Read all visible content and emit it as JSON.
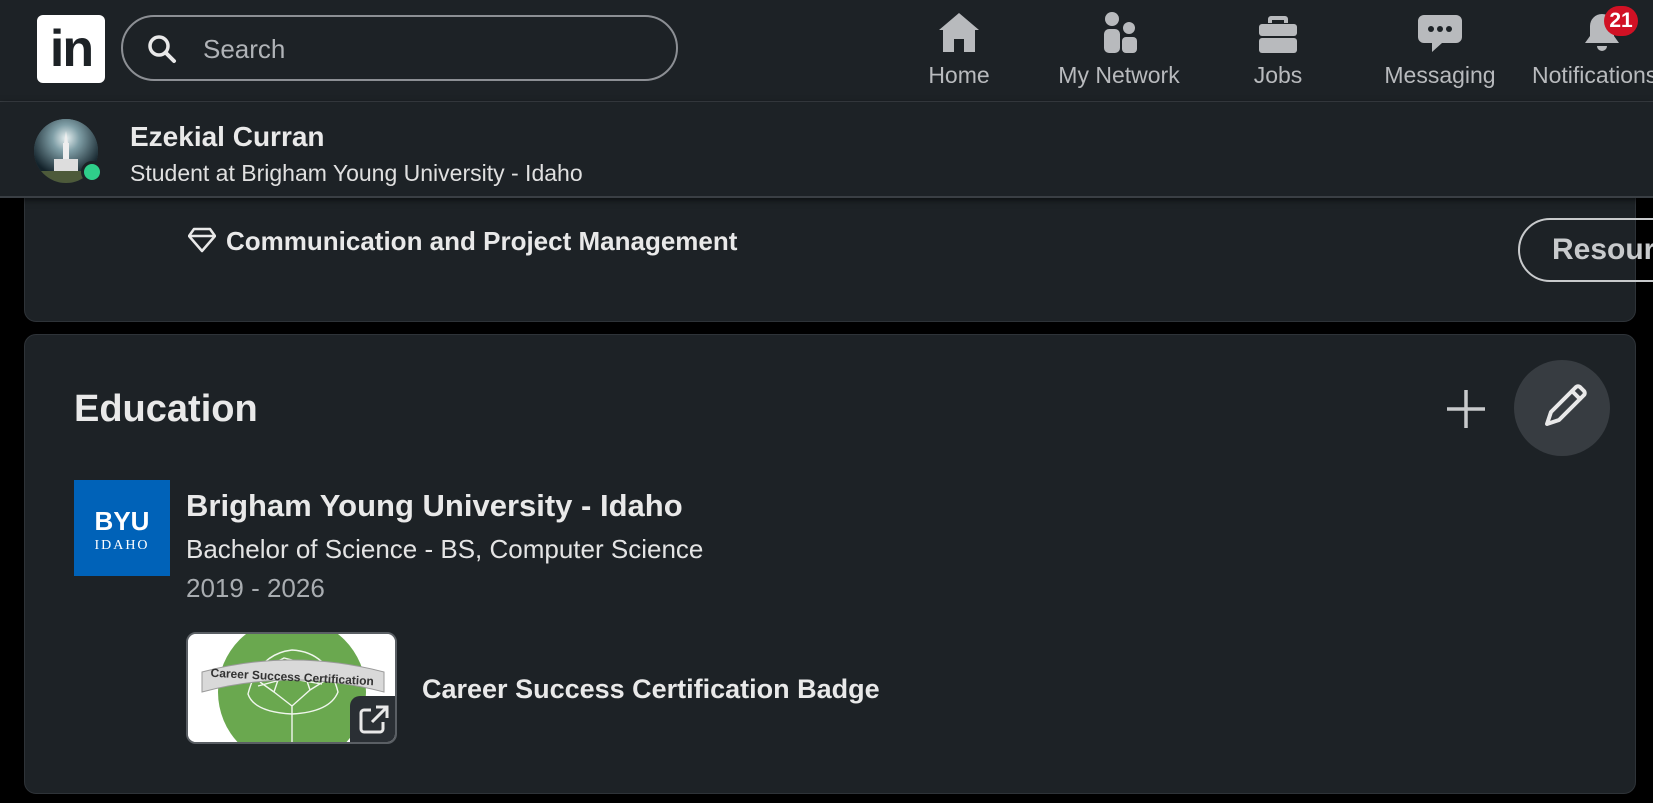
{
  "brand": {
    "logo_text": "in"
  },
  "search": {
    "placeholder": "Search"
  },
  "nav": {
    "home": "Home",
    "network": "My Network",
    "jobs": "Jobs",
    "messaging": "Messaging",
    "notifications": "Notifications",
    "notifications_count": "21"
  },
  "profile_bar": {
    "name": "Ezekial Curran",
    "headline": "Student at Brigham Young University - Idaho",
    "resources_label": "Resources"
  },
  "skills_card": {
    "skill": "Communication and Project Management"
  },
  "education": {
    "title": "Education",
    "school_logo": {
      "main": "BYU",
      "sub": "IDAHO"
    },
    "school": "Brigham Young University - Idaho",
    "degree": "Bachelor of Science - BS, Computer Science",
    "dates": "2019 - 2026",
    "media": {
      "thumbnail_text": "Career Success Certification",
      "title": "Career Success Certification Badge"
    }
  },
  "colors": {
    "page_bg": "#000000",
    "surface": "#1d2226",
    "badge_red": "#d11124",
    "online_green": "#2fcf8a",
    "byu_blue": "#0062b8",
    "badge_green": "#6aa84f"
  }
}
